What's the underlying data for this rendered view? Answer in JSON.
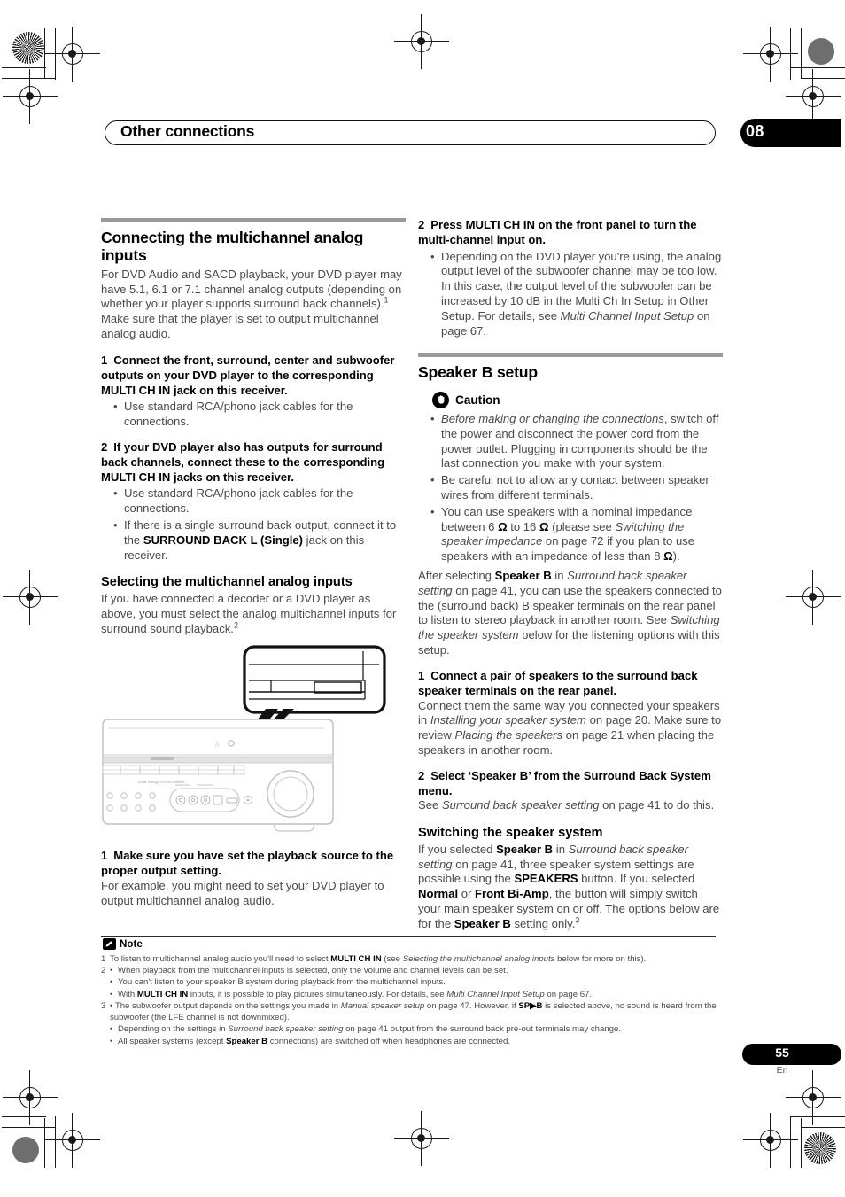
{
  "header": {
    "chapter_title": "Other connections",
    "chapter_number": "08"
  },
  "left_column": {
    "section_title": "Connecting the multichannel analog inputs",
    "intro_1": "For DVD Audio and SACD playback, your DVD player may have 5.1, 6.1 or 7.1 channel analog outputs (depending on whether your player supports surround back channels).",
    "intro_1_sup": "1",
    "intro_2": " Make sure that the player is set to output multichannel analog audio.",
    "step1_num": "1",
    "step1_text": "Connect the front, surround, center and subwoofer outputs on your DVD player to the corresponding MULTI CH IN jack on this receiver.",
    "step1_bullet1": "Use standard RCA/phono jack cables for the connections.",
    "step2_num": "2",
    "step2_text": "If your DVD player also has outputs for surround back channels, connect these to the corresponding MULTI CH IN jacks on this receiver.",
    "step2_bullet1": "Use standard RCA/phono jack cables for the connections.",
    "step2_bullet2_a": "If there is a single surround back output, connect it to the ",
    "step2_bullet2_bold": "SURROUND BACK L (Single)",
    "step2_bullet2_b": " jack on this receiver.",
    "subsection_title": "Selecting the multichannel analog inputs",
    "subsection_body_1": "If you have connected a decoder or a DVD player as above, you must select the analog multichannel inputs for surround sound playback.",
    "subsection_body_sup": "2",
    "after_image_step_num": "1",
    "after_image_step_text": "Make sure you have set the playback source to the proper output setting.",
    "after_image_body": "For example, you might need to set your DVD player to output multichannel analog audio.",
    "illustration_caption": "Dual Range Front Audible"
  },
  "right_column": {
    "step2_num": "2",
    "step2_text": "Press MULTI CH IN on the front panel to turn the multi-channel input on.",
    "step2_bullet_a": "Depending on the DVD player you're using, the analog output level of the subwoofer channel may be too low. In this case, the output level of the subwoofer can be increased by 10 dB in the Multi Ch In Setup in Other Setup. For details, see ",
    "step2_bullet_italic": "Multi Channel Input Setup",
    "step2_bullet_b": " on page 67.",
    "section_title": "Speaker B setup",
    "caution_label": "Caution",
    "caution_b1_italic": "Before making or changing the connections",
    "caution_b1_rest": ", switch off the power and disconnect the power cord from the power outlet. Plugging in components should be the last connection you make with your system.",
    "caution_b2": "Be careful not to allow any contact between speaker wires from different terminals.",
    "caution_b3_a": "You can use speakers with a nominal impedance between 6 ",
    "caution_b3_ohm1": "Ω",
    "caution_b3_b": " to 16 ",
    "caution_b3_ohm2": "Ω",
    "caution_b3_c": " (please see ",
    "caution_b3_italic": "Switching the speaker impedance",
    "caution_b3_d": " on page 72 if you plan to use speakers with an impedance of less than 8 ",
    "caution_b3_ohm3": "Ω",
    "caution_b3_e": ").",
    "after_caution_a": "After selecting ",
    "after_caution_bold": "Speaker B",
    "after_caution_b": " in ",
    "after_caution_italic1": "Surround back speaker setting",
    "after_caution_c": " on page 41, you can use the speakers connected to the (surround back) B speaker terminals on the rear panel to listen to stereo playback in another room. See ",
    "after_caution_italic2": "Switching the speaker system",
    "after_caution_d": " below for the listening options with this setup.",
    "step1_num": "1",
    "step1_text": "Connect a pair of speakers to the surround back speaker terminals on the rear panel.",
    "step1_body_a": "Connect them the same way you connected your speakers in ",
    "step1_body_italic1": "Installing your speaker system",
    "step1_body_b": " on page 20. Make sure to review ",
    "step1_body_italic2": "Placing the speakers",
    "step1_body_c": " on page 21 when placing the speakers in another room.",
    "step2b_num": "2",
    "step2b_text": "Select ‘Speaker B’ from the Surround Back System menu.",
    "step2b_body_a": "See ",
    "step2b_body_italic": "Surround back speaker setting",
    "step2b_body_b": " on page 41 to do this.",
    "subsection_title": "Switching the speaker system",
    "subsection_a": "If you selected ",
    "subsection_bold1": "Speaker B",
    "subsection_b": " in ",
    "subsection_italic1": "Surround back speaker setting",
    "subsection_c": " on page 41, three speaker system settings are possible using the ",
    "subsection_bold2": "SPEAKERS",
    "subsection_d": " button. If you selected ",
    "subsection_bold3": "Normal",
    "subsection_e": " or ",
    "subsection_bold4": "Front Bi-Amp",
    "subsection_f": ", the button will simply switch your main speaker system on or off. The options below are for the ",
    "subsection_bold5": "Speaker B",
    "subsection_g": " setting only.",
    "subsection_sup": "3"
  },
  "notes": {
    "label": "Note",
    "items": [
      {
        "num": "1",
        "parts": [
          {
            "t": "To listen to multichannel analog audio you'll need to select ",
            "s": "n"
          },
          {
            "t": "MULTI CH IN",
            "s": "b"
          },
          {
            "t": " (see ",
            "s": "n"
          },
          {
            "t": "Selecting the multichannel analog inputs",
            "s": "i"
          },
          {
            "t": " below for more on this).",
            "s": "n"
          }
        ]
      },
      {
        "num": "2",
        "bullets": [
          [
            {
              "t": "When playback from the multichannel inputs is selected, only the volume and channel levels can be set.",
              "s": "n"
            }
          ],
          [
            {
              "t": "You can't listen to your speaker B system during playback from the multichannel inputs.",
              "s": "n"
            }
          ],
          [
            {
              "t": "With ",
              "s": "n"
            },
            {
              "t": "MULTI CH IN",
              "s": "b"
            },
            {
              "t": " inputs, it is possible to play pictures simultaneously. For details, see ",
              "s": "n"
            },
            {
              "t": "Multi Channel Input Setup",
              "s": "i"
            },
            {
              "t": " on page 67.",
              "s": "n"
            }
          ]
        ]
      },
      {
        "num": "3",
        "lead": [
          {
            "t": "• The subwoofer output depends on the settings you made in ",
            "s": "n"
          },
          {
            "t": "Manual speaker setup",
            "s": "i"
          },
          {
            "t": " on page 47. However, if ",
            "s": "n"
          },
          {
            "t": "SP▶B",
            "s": "b"
          },
          {
            "t": " is selected above, no sound is heard from the subwoofer (the LFE channel is not downmixed).",
            "s": "n"
          }
        ],
        "bullets": [
          [
            {
              "t": "Depending on the settings in ",
              "s": "n"
            },
            {
              "t": "Surround back speaker setting",
              "s": "i"
            },
            {
              "t": " on page 41 output from the surround back pre-out terminals may change.",
              "s": "n"
            }
          ],
          [
            {
              "t": "All speaker systems (except ",
              "s": "n"
            },
            {
              "t": "Speaker B",
              "s": "b"
            },
            {
              "t": " connections) are switched off when headphones are connected.",
              "s": "n"
            }
          ]
        ]
      }
    ]
  },
  "footer": {
    "page_number": "55",
    "language": "En"
  },
  "colors": {
    "accent_black": "#000000",
    "rule_gray": "#9a9a9a",
    "body_text": "#4a4a4a"
  }
}
